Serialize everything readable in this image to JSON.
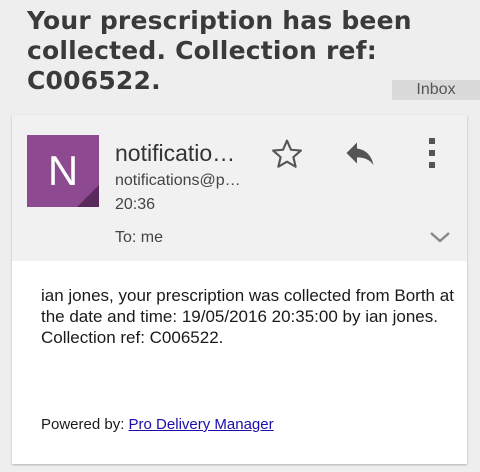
{
  "subject": "Your prescription has been collected. Collection ref: C006522.",
  "label": "Inbox",
  "email": {
    "avatar_letter": "N",
    "sender_name": "notificatio…",
    "sender_email": "notifications@p…",
    "time": "20:36",
    "to_line": "To: me",
    "body": "ian jones, your prescription was collected from Borth at the date and time: 19/05/2016 20:35:00 by ian jones. Collection ref: C006522.",
    "powered_prefix": "Powered by: ",
    "powered_link": "Pro Delivery Manager"
  },
  "icons": {
    "star": "star-outline-icon",
    "reply": "reply-icon",
    "more": "more-vertical-icon",
    "expand": "chevron-down-icon"
  },
  "colors": {
    "avatar": "#8e4a91",
    "header_bg": "#f1f1f1",
    "page_bg": "#eeeeee",
    "link": "#1a0dab"
  }
}
